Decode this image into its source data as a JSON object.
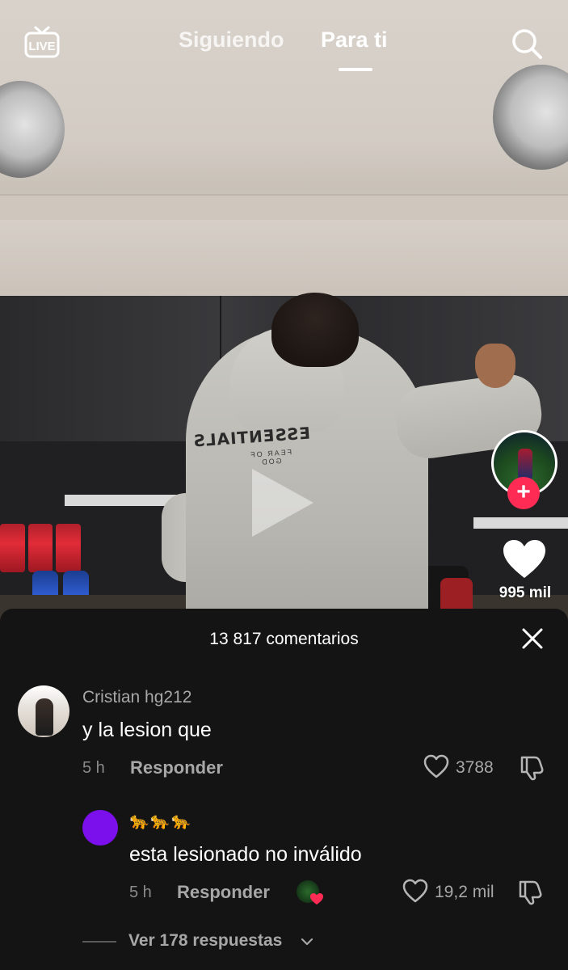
{
  "nav": {
    "live_label": "LIVE",
    "tabs": [
      {
        "label": "Siguiendo"
      },
      {
        "label": "Para ti"
      }
    ]
  },
  "video": {
    "hoodie_print": "ESSENTIALS",
    "hoodie_subprint": "FEAR OF GOD",
    "like_count": "995 mil",
    "follow_symbol": "+"
  },
  "comments_sheet": {
    "title": "13 817 comentarios",
    "comments": [
      {
        "username": "Cristian hg212",
        "text": "y la lesion que",
        "time": "5 h",
        "reply_label": "Responder",
        "likes": "3788"
      }
    ],
    "reply": {
      "username": "🐆🐆🐆",
      "text": "esta lesionado no inválido",
      "time": "5 h",
      "reply_label": "Responder",
      "likes": "19,2 mil"
    },
    "view_replies": "Ver 178 respuestas"
  },
  "colors": {
    "accent": "#fe2c55",
    "sheet_bg": "#141414",
    "muted_text": "#a7a7a7"
  },
  "icons": [
    "live-icon",
    "search-icon",
    "play-icon",
    "heart-icon",
    "close-icon",
    "dislike-icon",
    "chevron-down-icon"
  ]
}
